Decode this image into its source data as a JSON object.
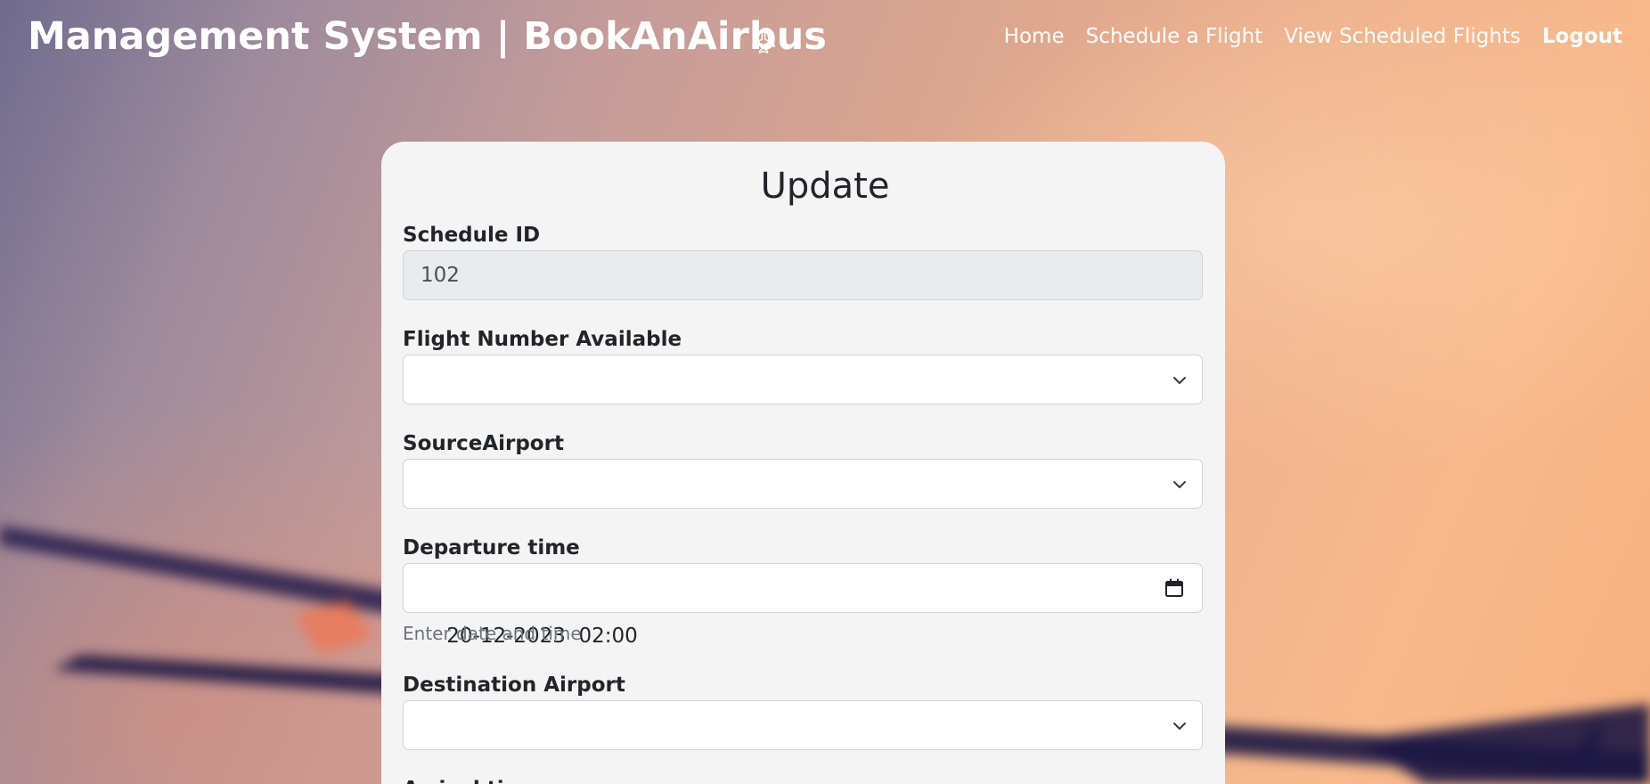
{
  "navbar": {
    "brand": "Management System | BookAnAirbus",
    "brand_icon": "airplane-icon",
    "links": [
      {
        "label": "Home"
      },
      {
        "label": "Schedule a Flight"
      },
      {
        "label": "View Scheduled Flights"
      },
      {
        "label": "Logout"
      }
    ]
  },
  "form": {
    "title": "Update",
    "schedule_id": {
      "label": "Schedule ID",
      "value": "102"
    },
    "flight_number": {
      "label": "Flight Number Available",
      "value": ""
    },
    "source_airport": {
      "label": "SourceAirport",
      "value": ""
    },
    "departure_time": {
      "label": "Departure time",
      "value": "20-12-2023  02:00",
      "help": "Enter date and time",
      "icon": "calendar-icon"
    },
    "destination_airport": {
      "label": "Destination Airport",
      "value": ""
    },
    "arrival_time": {
      "label": "Arrival time"
    }
  },
  "colors": {
    "card_background": "#f4f4f4",
    "text": "#212529",
    "muted_text": "#6c757d",
    "readonly_background": "#e9ecef"
  }
}
